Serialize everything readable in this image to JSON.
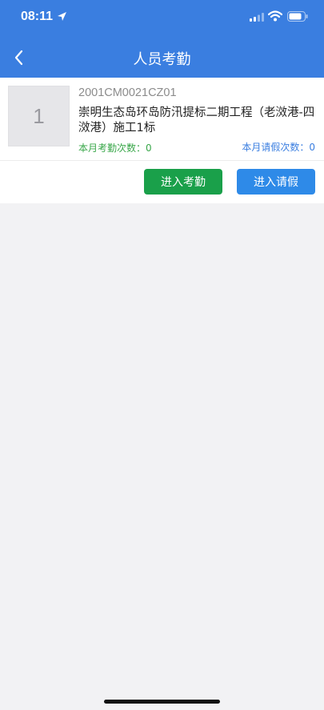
{
  "status_bar": {
    "time": "08:11"
  },
  "header": {
    "title": "人员考勤"
  },
  "card": {
    "thumbnail_text": "1",
    "code": "2001CM0021CZ01",
    "project_name": "崇明生态岛环岛防汛提标二期工程（老滧港-四滧港）施工1标",
    "attendance_count": "本月考勤次数：0",
    "leave_count": "本月请假次数：0",
    "attendance_button": "进入考勤",
    "leave_button": "进入请假"
  },
  "colors": {
    "primary": "#3a7ee0",
    "green": "#1aa04a",
    "blue_button": "#2e8ae8"
  }
}
